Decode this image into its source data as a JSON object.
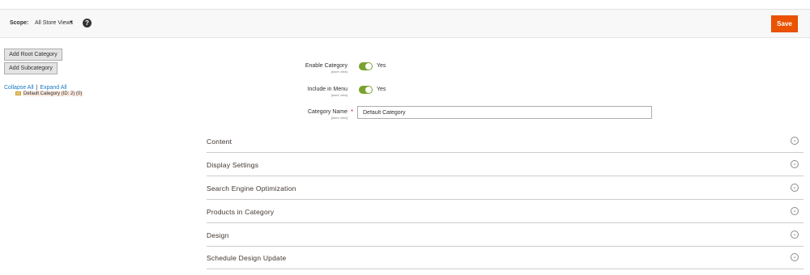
{
  "scope": {
    "label": "Scope:",
    "value": "All Store Views",
    "help": "?"
  },
  "header": {
    "save_label": "Save"
  },
  "tree": {
    "add_root_label": "Add Root Category",
    "add_sub_label": "Add Subcategory",
    "collapse_all": "Collapse All",
    "separator": "|",
    "expand_all": "Expand All",
    "nodes": [
      {
        "label": "Default Category (ID: 2) (0)"
      }
    ]
  },
  "form": {
    "enable_category": {
      "label": "Enable Category",
      "scope": "[store view]",
      "value": "Yes",
      "on": true
    },
    "include_in_menu": {
      "label": "Include in Menu",
      "scope": "[store view]",
      "value": "Yes",
      "on": true
    },
    "category_name": {
      "label": "Category Name",
      "scope": "[store view]",
      "required": "*",
      "value": "Default Category"
    }
  },
  "sections": [
    {
      "title": "Content"
    },
    {
      "title": "Display Settings"
    },
    {
      "title": "Search Engine Optimization"
    },
    {
      "title": "Products in Category"
    },
    {
      "title": "Design"
    },
    {
      "title": "Schedule Design Update"
    }
  ],
  "colors": {
    "accent": "#eb5202",
    "toggle_on": "#79a22e",
    "link": "#1979c3"
  }
}
